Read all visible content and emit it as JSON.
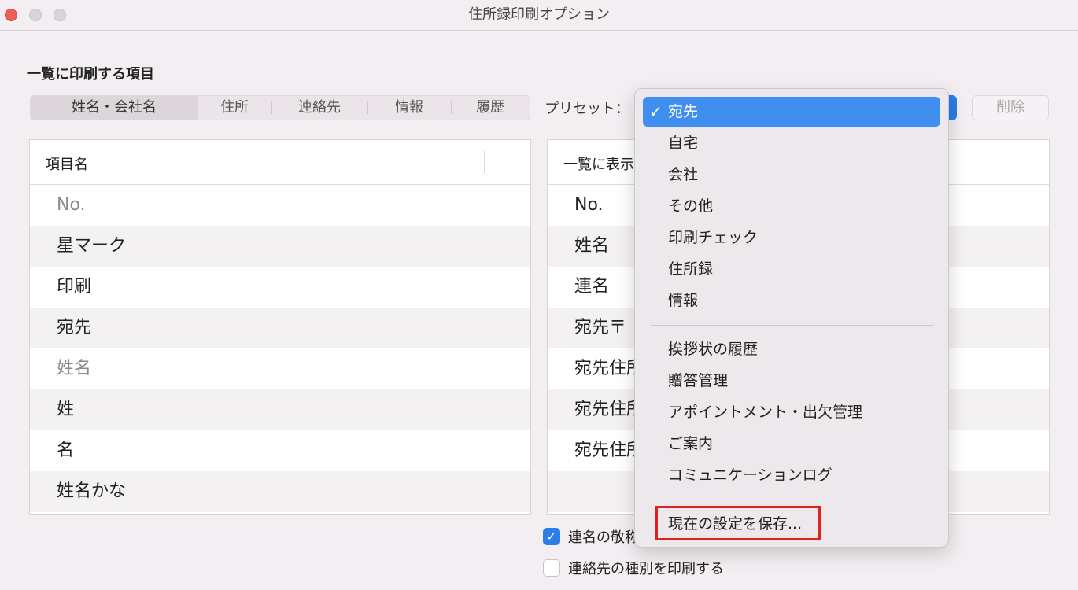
{
  "window": {
    "title": "住所録印刷オプション"
  },
  "section": {
    "title": "一覧に印刷する項目"
  },
  "tabs": [
    {
      "label": "姓名・会社名",
      "active": true
    },
    {
      "label": "住所",
      "active": false
    },
    {
      "label": "連絡先",
      "active": false
    },
    {
      "label": "情報",
      "active": false
    },
    {
      "label": "履歴",
      "active": false
    }
  ],
  "preset": {
    "label": "プリセット："
  },
  "delete_button": {
    "label": "削除"
  },
  "left_table": {
    "header": "項目名",
    "rows": [
      "No.",
      "星マーク",
      "印刷",
      "宛先",
      "姓名",
      "姓",
      "名",
      "姓名かな"
    ]
  },
  "right_table": {
    "header": "一覧に表示",
    "rows": [
      "No.",
      "姓名",
      "連名",
      "宛先〒",
      "宛先住所",
      "宛先住所",
      "宛先住所"
    ]
  },
  "checkboxes": [
    {
      "label": "連名の敬称",
      "checked": true
    },
    {
      "label": "連絡先の種別を印刷する",
      "checked": false
    }
  ],
  "menu": {
    "check_mark": "✓",
    "group1": [
      "宛先",
      "自宅",
      "会社",
      "その他",
      "印刷チェック",
      "住所録",
      "情報"
    ],
    "group2": [
      "挨拶状の履歴",
      "贈答管理",
      "アポイントメント・出欠管理",
      "ご案内",
      "コミュニケーションログ"
    ],
    "save_item": "現在の設定を保存..."
  },
  "colors": {
    "accent": "#3f8ef0",
    "highlight": "#e0221f"
  }
}
